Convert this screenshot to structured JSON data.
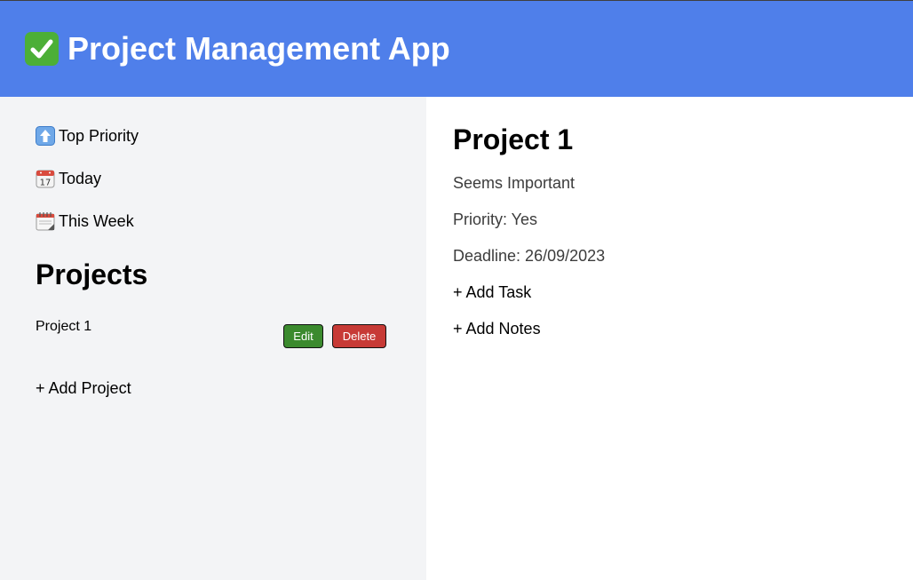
{
  "app": {
    "title": "Project Management App",
    "header_icon": "check-mark-icon"
  },
  "colors": {
    "header_bg": "#4f7fea",
    "sidebar_bg": "#f3f4f6",
    "main_bg": "#ffffff",
    "edit_button": "#3b8a2e",
    "delete_button": "#c73a36",
    "check_icon_bg": "#4caf37"
  },
  "sidebar": {
    "nav": [
      {
        "label": "Top Priority",
        "icon": "up-arrow-icon"
      },
      {
        "label": "Today",
        "icon": "calendar-icon"
      },
      {
        "label": "This Week",
        "icon": "spiral-calendar-icon"
      }
    ],
    "projects_heading": "Projects",
    "projects": [
      {
        "name": "Project 1",
        "edit_label": "Edit",
        "delete_label": "Delete"
      }
    ],
    "add_project_label": "+ Add Project"
  },
  "detail": {
    "title": "Project 1",
    "description": "Seems Important",
    "priority": "Priority: Yes",
    "deadline": "Deadline: 26/09/2023",
    "add_task_label": "+ Add Task",
    "add_notes_label": "+ Add Notes"
  }
}
